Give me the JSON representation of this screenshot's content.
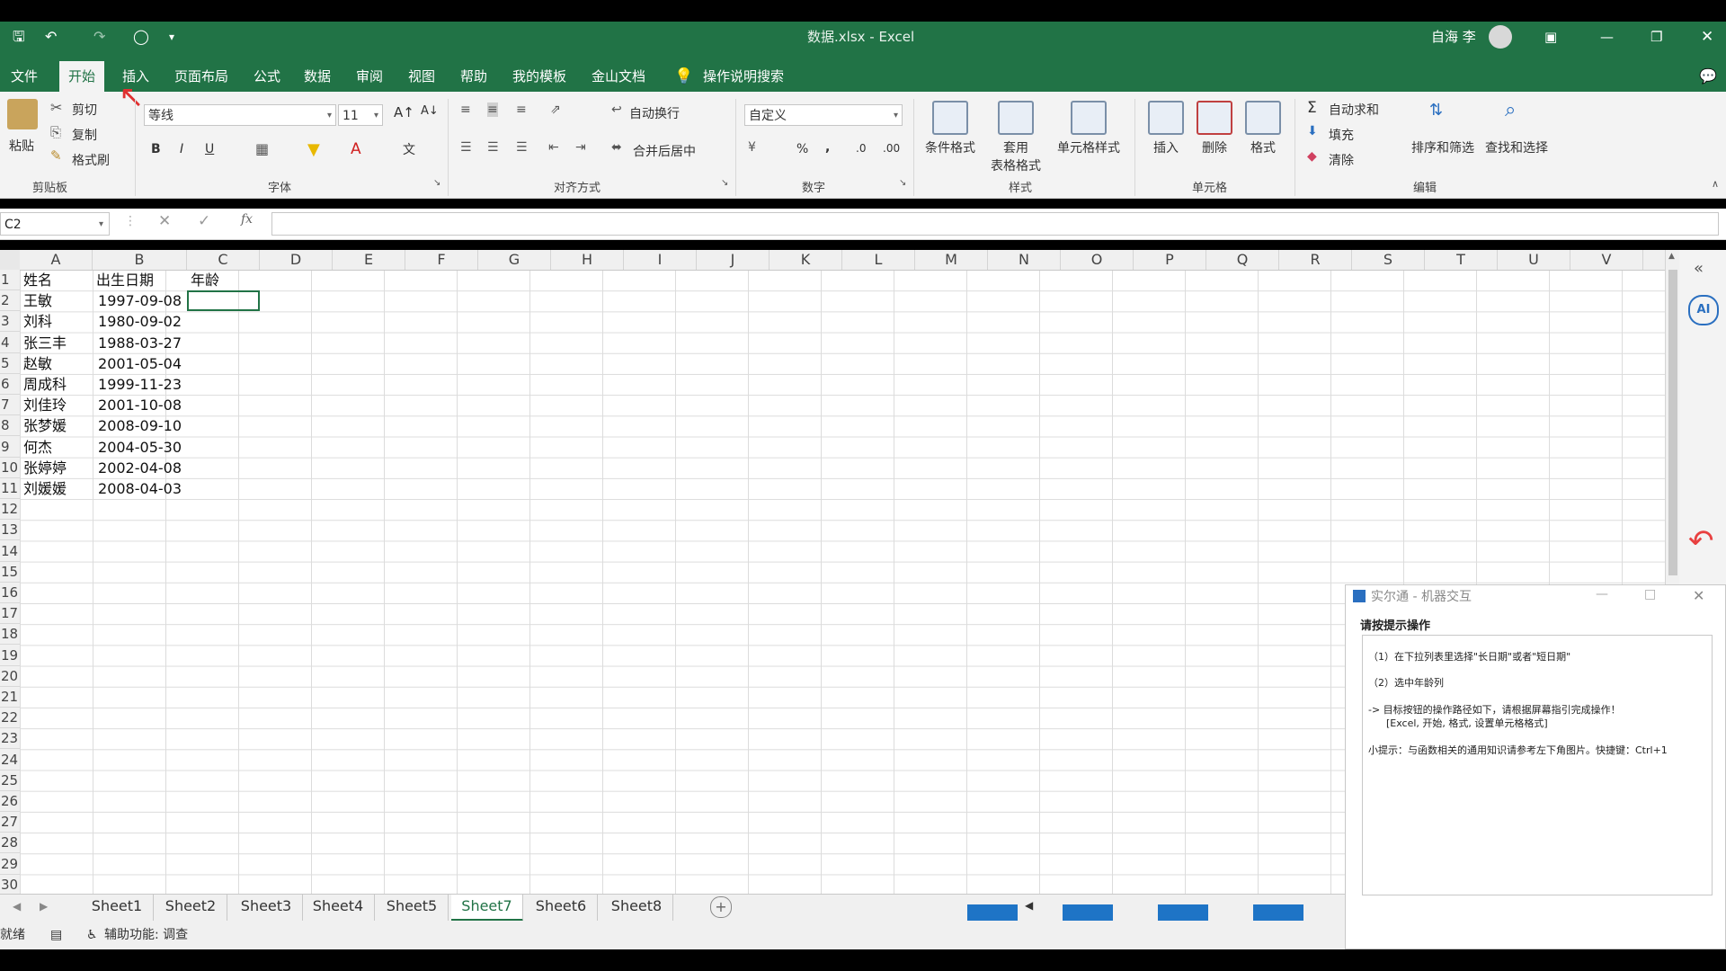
{
  "window": {
    "title": "数据.xlsx  -  Excel",
    "user": "自海 李"
  },
  "tellme": "操作说明搜索",
  "menu": [
    "文件",
    "开始",
    "插入",
    "页面布局",
    "公式",
    "数据",
    "审阅",
    "视图",
    "帮助",
    "我的模板",
    "金山文档"
  ],
  "ribbon": {
    "clipboard": {
      "paste": "粘贴",
      "cut": "剪切",
      "copy": "复制",
      "format_painter": "格式刷",
      "label": "剪贴板"
    },
    "font": {
      "name": "等线",
      "size": "11",
      "label": "字体"
    },
    "alignment": {
      "wrap": "自动换行",
      "merge": "合并后居中",
      "label": "对齐方式"
    },
    "number": {
      "format": "自定义",
      "label": "数字"
    },
    "styles": {
      "conditional": "条件格式",
      "table1": "套用",
      "table2": "表格格式",
      "cell_styles": "单元格样式",
      "label": "样式"
    },
    "cells": {
      "insert": "插入",
      "delete": "删除",
      "format": "格式",
      "label": "单元格"
    },
    "editing": {
      "autosum": "自动求和",
      "fill": "填充",
      "clear": "清除",
      "sort": "排序和筛选",
      "find": "查找和选择",
      "label": "编辑"
    }
  },
  "formula_bar": {
    "name_box": "C2",
    "fx": "fx"
  },
  "columns": [
    "A",
    "B",
    "C",
    "D",
    "E",
    "F",
    "G",
    "H",
    "I",
    "J",
    "K",
    "L",
    "M",
    "N",
    "O",
    "P",
    "Q",
    "R",
    "S",
    "T",
    "U",
    "V"
  ],
  "rows": [
    "1",
    "2",
    "3",
    "4",
    "5",
    "6",
    "7",
    "8",
    "9",
    "10",
    "11",
    "12",
    "13",
    "14",
    "15",
    "16",
    "17",
    "18",
    "19",
    "20",
    "21",
    "22",
    "23",
    "24",
    "25",
    "26",
    "27",
    "28",
    "29",
    "30"
  ],
  "table": {
    "headers": [
      "姓名",
      "出生日期",
      "年龄"
    ],
    "names": [
      "王敏",
      "刘科",
      "张三丰",
      "赵敏",
      "周成科",
      "刘佳玲",
      "张梦媛",
      "何杰",
      "张婷婷",
      "刘媛媛"
    ],
    "dates": [
      "1997-09-08",
      "1980-09-02",
      "1988-03-27",
      "2001-05-04",
      "1999-11-23",
      "2001-10-08",
      "2008-09-10",
      "2004-05-30",
      "2002-04-08",
      "2008-04-03"
    ]
  },
  "sheets": [
    "Sheet1",
    "Sheet2",
    "Sheet3",
    "Sheet4",
    "Sheet5",
    "Sheet7",
    "Sheet6",
    "Sheet8"
  ],
  "active_sheet": "Sheet7",
  "status": {
    "ready": "就绪",
    "accessibility": "辅助功能: 调查"
  },
  "dialog": {
    "title": "实尔通 - 机器交互",
    "heading": "请按提示操作",
    "step1": "（1）在下拉列表里选择\"长日期\"或者\"短日期\"",
    "step2": "（2）选中年龄列",
    "path_intro": "-> 目标按钮的操作路径如下，请根据屏幕指引完成操作！",
    "path": "[Excel, 开始, 格式, 设置单元格格式]",
    "tip": "小提示：与函数相关的通用知识请参考左下角图片。快捷键：Ctrl+1"
  },
  "colors": {
    "accent": "#217346",
    "ribbon_bg": "#f3f3f3"
  }
}
